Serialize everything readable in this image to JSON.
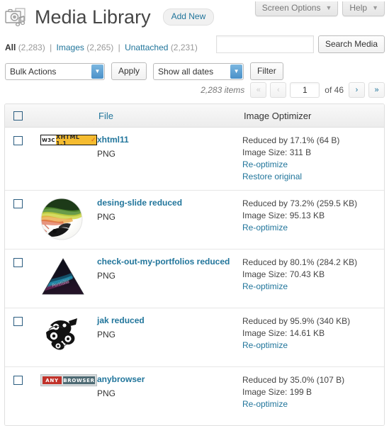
{
  "screen_meta": [
    {
      "label": "Screen Options",
      "icon": "chevron-down-icon"
    },
    {
      "label": "Help",
      "icon": "chevron-down-icon"
    }
  ],
  "header": {
    "icon": "media-library-icon",
    "title": "Media Library",
    "add_new_label": "Add New"
  },
  "filters": {
    "all": {
      "label": "All",
      "count": "(2,283)"
    },
    "images": {
      "label": "Images",
      "count": "(2,265)"
    },
    "unattached": {
      "label": "Unattached",
      "count": "(2,231)"
    },
    "separator": "|"
  },
  "search": {
    "value": "",
    "placeholder": "",
    "button_label": "Search Media"
  },
  "tablenav": {
    "bulk_actions_label": "Bulk Actions",
    "apply_label": "Apply",
    "dates_label": "Show all dates",
    "filter_label": "Filter",
    "items_text": "2,283 items",
    "first_page_label": "«",
    "prev_page_label": "‹",
    "current_page": "1",
    "of_label": "of 46",
    "next_page_label": "›",
    "last_page_label": "»"
  },
  "table": {
    "columns": {
      "select_all": "select-all-checkbox",
      "file": "File",
      "image_optimizer": "Image Optimizer"
    },
    "rows": [
      {
        "thumb": "w3c-xhtml-badge",
        "thumb_text": {
          "left": "W3C",
          "right": "XHTML 1.1",
          "check": "✓"
        },
        "title": "xhtml11",
        "type": "PNG",
        "reduced": "Reduced by 17.1% (64 B)",
        "image_size": "Image Size: 311 B",
        "actions": [
          "Re-optimize",
          "Restore original"
        ]
      },
      {
        "thumb": "desing-slide-thumbnail",
        "title": "desing-slide reduced",
        "type": "PNG",
        "reduced": "Reduced by 73.2% (259.5 KB)",
        "image_size": "Image Size: 95.13 KB",
        "actions": [
          "Re-optimize"
        ]
      },
      {
        "thumb": "portfolio-triangle-thumbnail",
        "title": "check-out-my-portfolios reduced",
        "type": "PNG",
        "reduced": "Reduced by 80.1% (284.2 KB)",
        "image_size": "Image Size: 70.43 KB",
        "actions": [
          "Re-optimize"
        ]
      },
      {
        "thumb": "jak-graffiti-thumbnail",
        "title": "jak reduced",
        "type": "PNG",
        "reduced": "Reduced by 95.9% (340 KB)",
        "image_size": "Image Size: 14.61 KB",
        "actions": [
          "Re-optimize"
        ]
      },
      {
        "thumb": "anybrowser-badge",
        "thumb_text": {
          "left": "ANY",
          "right": "BROWSER"
        },
        "title": "anybrowser",
        "type": "PNG",
        "reduced": "Reduced by 35.0% (107 B)",
        "image_size": "Image Size: 199 B",
        "actions": [
          "Re-optimize"
        ]
      }
    ]
  },
  "colors": {
    "link": "#21759b",
    "title": "#464646",
    "muted": "#999999",
    "badge_gold": "#f5bc30",
    "badge_red": "#c1322a",
    "badge_slate": "#4e6a73"
  }
}
